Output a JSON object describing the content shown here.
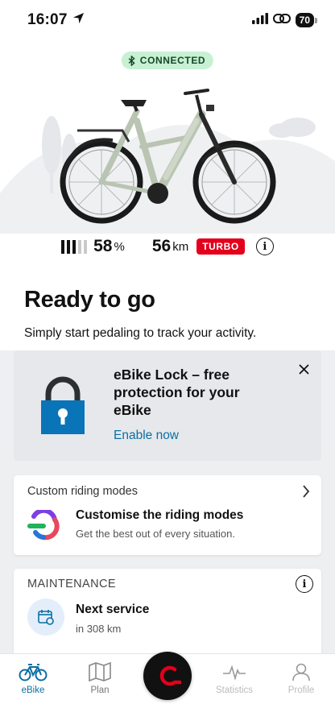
{
  "status_bar": {
    "time": "16:07",
    "battery": "70"
  },
  "hero": {
    "connection_label": "CONNECTED",
    "battery_percent": "58",
    "battery_unit": "%",
    "battery_level_bars": 3,
    "range_value": "56",
    "range_unit": "km",
    "mode_badge": "TURBO"
  },
  "ready": {
    "title": "Ready to go",
    "subtitle": "Simply start pedaling to track your activity."
  },
  "lock_card": {
    "title": "eBike Lock – free protection for your eBike",
    "link": "Enable now"
  },
  "riding_modes_card": {
    "header": "Custom riding modes",
    "title": "Customise the riding modes",
    "subtitle": "Get the best out of every situation."
  },
  "maintenance_card": {
    "header": "MAINTENANCE",
    "title": "Next service",
    "subtitle": "in 308 km"
  },
  "tabbar": {
    "tabs": [
      {
        "label": "eBike",
        "icon": "bike-icon"
      },
      {
        "label": "Plan",
        "icon": "map-icon"
      },
      {
        "label": "Statistics",
        "icon": "pulse-icon"
      },
      {
        "label": "Profile",
        "icon": "person-icon"
      }
    ]
  },
  "colors": {
    "accent": "#0b6fa3",
    "turbo": "#e3001b",
    "connected_bg": "#c8f0d3",
    "lock_blue": "#0a74b8"
  }
}
